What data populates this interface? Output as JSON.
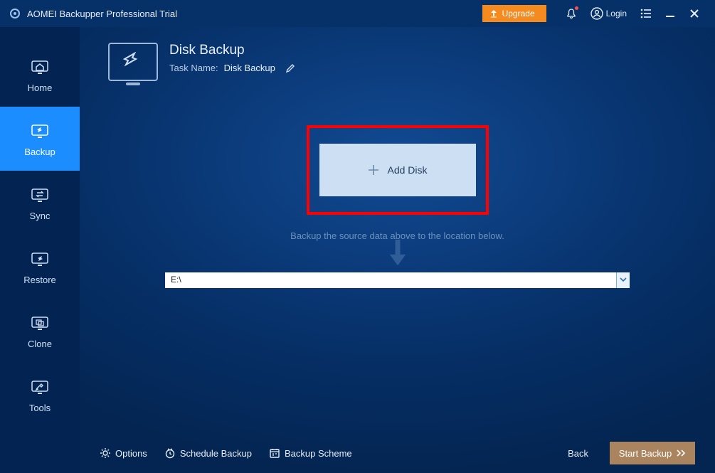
{
  "titlebar": {
    "app_title": "AOMEI Backupper Professional Trial",
    "upgrade_label": "Upgrade",
    "login_label": "Login"
  },
  "sidebar": {
    "items": [
      {
        "label": "Home"
      },
      {
        "label": "Backup"
      },
      {
        "label": "Sync"
      },
      {
        "label": "Restore"
      },
      {
        "label": "Clone"
      },
      {
        "label": "Tools"
      }
    ]
  },
  "header": {
    "title": "Disk Backup",
    "task_label": "Task Name:",
    "task_name": "Disk Backup"
  },
  "center": {
    "add_disk_label": "Add Disk",
    "hint": "Backup the source data above to the location below."
  },
  "destination": {
    "value": "E:\\"
  },
  "footer": {
    "options_label": "Options",
    "schedule_label": "Schedule Backup",
    "scheme_label": "Backup Scheme",
    "back_label": "Back",
    "start_label": "Start Backup"
  }
}
